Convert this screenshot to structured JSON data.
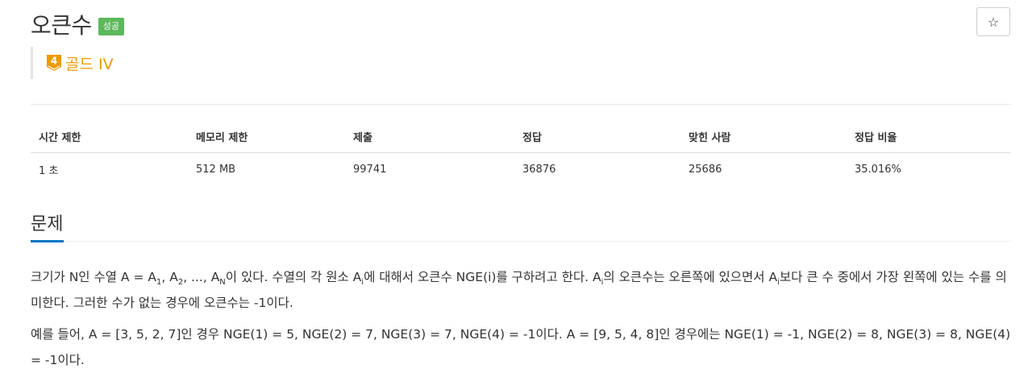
{
  "problem": {
    "title": "오큰수",
    "result_badge": "성공",
    "star_label": "☆",
    "tier": {
      "label": "골드 IV",
      "number": "4",
      "color": "#ec9a00"
    }
  },
  "info_table": {
    "headers": [
      "시간 제한",
      "메모리 제한",
      "제출",
      "정답",
      "맞힌 사람",
      "정답 비율"
    ],
    "values": [
      "1 초",
      "512 MB",
      "99741",
      "36876",
      "25686",
      "35.016%"
    ]
  },
  "section": {
    "title": "문제"
  },
  "description": {
    "p1": {
      "t1": "크기가 N인 수열 A = A",
      "s1": "1",
      "t2": ", A",
      "s2": "2",
      "t3": ", ..., A",
      "s3": "N",
      "t4": "이 있다. 수열의 각 원소 A",
      "s4": "i",
      "t5": "에 대해서 오큰수 NGE(i)를 구하려고 한다. A",
      "s5": "i",
      "t6": "의 오큰수는 오른쪽에 있으면서 A",
      "s6": "i",
      "t7": "보다 큰 수 중에서 가장 왼쪽에 있는 수를 의미한다. 그러한 수가 없는 경우에 오큰수는 -1이다."
    },
    "p2": "예를 들어, A = [3, 5, 2, 7]인 경우 NGE(1) = 5, NGE(2) = 7, NGE(3) = 7, NGE(4) = -1이다. A = [9, 5, 4, 8]인 경우에는 NGE(1) = -1, NGE(2) = 8, NGE(3) = 8, NGE(4) = -1이다."
  },
  "colors": {
    "success_badge": "#5cb85c",
    "tier_gold": "#ec9a00",
    "section_accent": "#0076c0"
  },
  "icons": {
    "star": "star-icon",
    "tier": "gold-tier-icon"
  }
}
